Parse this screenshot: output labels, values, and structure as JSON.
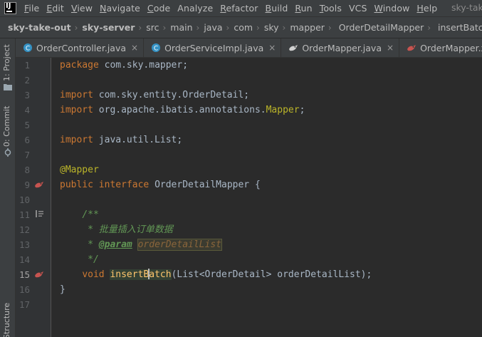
{
  "menubar": {
    "items": [
      {
        "underline": "F",
        "rest": "ile"
      },
      {
        "underline": "E",
        "rest": "dit"
      },
      {
        "underline": "V",
        "rest": "iew"
      },
      {
        "underline": "N",
        "rest": "avigate"
      },
      {
        "underline": "C",
        "rest": "ode"
      },
      {
        "underline": "",
        "rest": "Analyze"
      },
      {
        "underline": "R",
        "rest": "efactor"
      },
      {
        "underline": "B",
        "rest": "uild"
      },
      {
        "underline": "R",
        "rest": "un"
      },
      {
        "underline": "T",
        "rest": "ools"
      },
      {
        "underline": "",
        "rest": "VCS"
      },
      {
        "underline": "W",
        "rest": "indow"
      },
      {
        "underline": "H",
        "rest": "elp"
      }
    ],
    "window_title": "sky-take"
  },
  "breadcrumb": [
    "sky-take-out",
    "sky-server",
    "src",
    "main",
    "java",
    "com",
    "sky",
    "mapper",
    "OrderDetailMapper",
    "insertBatch"
  ],
  "left_tools": {
    "project": "1: Project",
    "commit": "0: Commit",
    "structure": "Structure"
  },
  "tabs": [
    {
      "label": "OrderController.java",
      "icon": "class-icon"
    },
    {
      "label": "OrderServiceImpl.java",
      "icon": "class-icon"
    },
    {
      "label": "OrderMapper.java",
      "icon": "mybatis-icon"
    },
    {
      "label": "OrderMapper.xml",
      "icon": "mybatis-icon"
    }
  ],
  "tab_close": "×",
  "editor": {
    "line_numbers": [
      "1",
      "2",
      "3",
      "4",
      "5",
      "6",
      "7",
      "8",
      "9",
      "10",
      "11",
      "12",
      "13",
      "14",
      "15",
      "16",
      "17"
    ],
    "current_line": 15,
    "code": {
      "l1_kw": "package",
      "l1_rest": " com.sky.mapper;",
      "l3_kw": "import",
      "l3_rest": " com.sky.entity.OrderDetail;",
      "l4_kw": "import",
      "l4_rest": " org.apache.ibatis.annotations.",
      "l4_ann": "Mapper",
      "l4_end": ";",
      "l6_kw": "import",
      "l6_rest": " java.util.List;",
      "l8_ann": "@Mapper",
      "l9_kw1": "public",
      "l9_kw2": "interface",
      "l9_rest": " OrderDetailMapper {",
      "l11_doc": "/**",
      "l12_doc": " * 批量插入订单数据",
      "l13_star": " * ",
      "l13_tag": "@param",
      "l13_param": "orderDetailList",
      "l14_doc": " */",
      "l15_kw": "void",
      "l15_m1": "insertB",
      "l15_m2": "atch",
      "l15_rest": "(List<OrderDetail> orderDetailList);",
      "l16": "}"
    }
  },
  "colors": {
    "background": "#2b2b2b",
    "gutter": "#313335",
    "panel": "#3c3f41",
    "keyword": "#cc7832",
    "annotation": "#bbb529",
    "doc_comment": "#629755",
    "method": "#ffc66d",
    "text": "#a9b7c6"
  }
}
